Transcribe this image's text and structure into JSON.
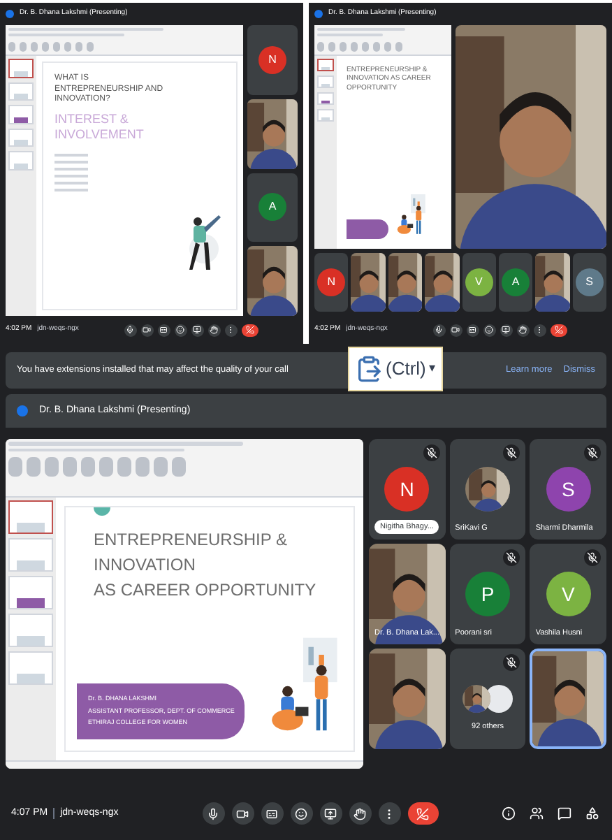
{
  "top_left": {
    "header": "Dr. B. Dhana Lakshmi (Presenting)",
    "slide": {
      "title": "WHAT IS ENTREPRENEURSHIP AND INNOVATION?",
      "subtitle": "INTEREST & INVOLVEMENT"
    },
    "tiles": [
      {
        "kind": "avatar",
        "letter": "N",
        "color": "#d93025"
      },
      {
        "kind": "video"
      },
      {
        "kind": "avatar",
        "letter": "A",
        "color": "#188038"
      },
      {
        "kind": "video"
      }
    ],
    "time": "4:02 PM",
    "code": "jdn-weqs-ngx"
  },
  "top_right": {
    "header": "Dr. B. Dhana Lakshmi (Presenting)",
    "slide": {
      "title": "ENTREPRENEURSHIP & INNOVATION AS CAREER OPPORTUNITY"
    },
    "strip": [
      {
        "kind": "avatar",
        "letter": "N",
        "color": "#d93025"
      },
      {
        "kind": "video"
      },
      {
        "kind": "video"
      },
      {
        "kind": "video"
      },
      {
        "kind": "avatar",
        "letter": "V",
        "color": "#7cb342"
      },
      {
        "kind": "avatar",
        "letter": "A",
        "color": "#188038"
      },
      {
        "kind": "video"
      },
      {
        "kind": "avatar",
        "letter": "S",
        "color": "#5f7a8a"
      }
    ],
    "time": "4:02 PM",
    "code": "jdn-weqs-ngx"
  },
  "banner": {
    "text": "You have extensions installed that may affect the quality of your call",
    "links": [
      "Learn more",
      "Dismiss"
    ]
  },
  "paste_popup": {
    "label": "(Ctrl)",
    "caret": "▾"
  },
  "header": "Dr. B. Dhana Lakshmi (Presenting)",
  "slide": {
    "title_lines": [
      "ENTREPRENEURSHIP &",
      "INNOVATION",
      "AS CAREER OPPORTUNITY"
    ],
    "presenter_lines": [
      "Dr. B. DHANA LAKSHMI",
      "ASSISTANT PROFESSOR, DEPT. OF COMMERCE",
      "ETHIRAJ COLLEGE FOR WOMEN"
    ]
  },
  "tiles": [
    {
      "kind": "avatar",
      "letter": "N",
      "color": "#d93025",
      "name": "Nigitha Bhagy..."
    },
    {
      "name": "SriKavi G"
    },
    {
      "kind": "avatar",
      "letter": "S",
      "color": "#8e44ad",
      "name": "Sharmi Dharmila"
    },
    {
      "kind": "video",
      "name": "Dr. B. Dhana Lak..."
    },
    {
      "kind": "avatar",
      "letter": "P",
      "color": "#188038",
      "name": "Poorani sri"
    },
    {
      "kind": "avatar",
      "letter": "V",
      "color": "#7cb342",
      "name": "Vashila Husni"
    },
    {
      "kind": "video"
    },
    {
      "kind": "others",
      "name": "92 others"
    },
    {
      "kind": "video",
      "pinned": true
    }
  ],
  "time": "4:07 PM",
  "code": "jdn-weqs-ngx"
}
